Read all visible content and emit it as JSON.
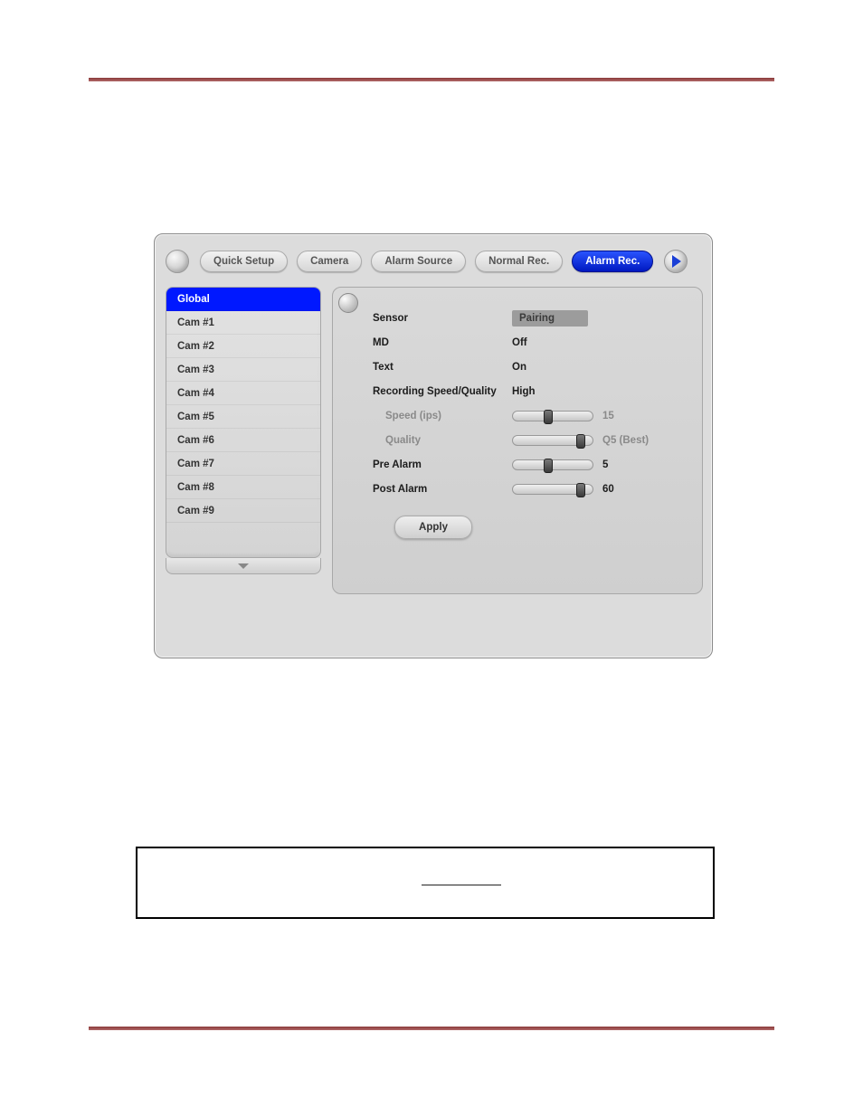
{
  "tabs": {
    "quick_setup": "Quick Setup",
    "camera": "Camera",
    "alarm_source": "Alarm Source",
    "normal_rec": "Normal Rec.",
    "alarm_rec": "Alarm Rec."
  },
  "sidebar": {
    "items": [
      "Global",
      "Cam #1",
      "Cam #2",
      "Cam #3",
      "Cam #4",
      "Cam #5",
      "Cam #6",
      "Cam #7",
      "Cam #8",
      "Cam #9"
    ],
    "selected_index": 0
  },
  "settings": {
    "sensor_label": "Sensor",
    "sensor_value": "Pairing",
    "md_label": "MD",
    "md_value": "Off",
    "text_label": "Text",
    "text_value": "On",
    "rec_sq_label": "Recording Speed/Quality",
    "rec_sq_value": "High",
    "speed_label": "Speed (ips)",
    "speed_value": "15",
    "speed_pos_pct": 42,
    "quality_label": "Quality",
    "quality_value": "Q5 (Best)",
    "quality_pos_pct": 88,
    "pre_alarm_label": "Pre Alarm",
    "pre_alarm_value": "5",
    "pre_alarm_pos_pct": 42,
    "post_alarm_label": "Post Alarm",
    "post_alarm_value": "60",
    "post_alarm_pos_pct": 88,
    "apply_label": "Apply"
  }
}
